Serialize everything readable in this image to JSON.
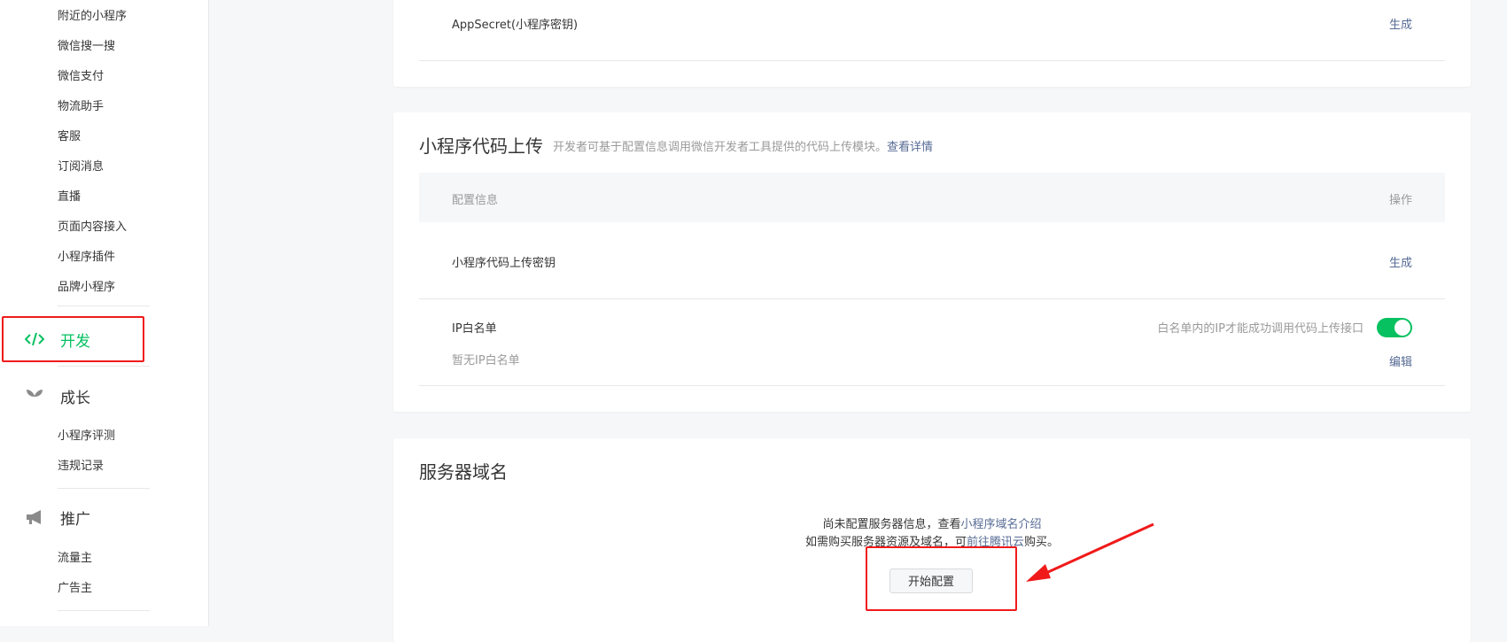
{
  "sidebar": {
    "top_items": [
      "附近的小程序",
      "微信搜一搜",
      "微信支付",
      "物流助手",
      "客服",
      "订阅消息",
      "直播",
      "页面内容接入",
      "小程序插件",
      "品牌小程序"
    ],
    "dev": {
      "label": "开发",
      "icon": "code-icon"
    },
    "growth": {
      "label": "成长",
      "icon": "sprout-icon",
      "items": [
        "小程序评测",
        "违规记录"
      ]
    },
    "promo": {
      "label": "推广",
      "icon": "megaphone-icon",
      "items": [
        "流量主",
        "广告主"
      ]
    }
  },
  "appsecret": {
    "label": "AppSecret(小程序密钥)",
    "action": "生成"
  },
  "upload": {
    "title": "小程序代码上传",
    "desc": "开发者可基于配置信息调用微信开发者工具提供的代码上传模块。",
    "desc_link": "查看详情",
    "col_config": "配置信息",
    "col_action": "操作",
    "key_label": "小程序代码上传密钥",
    "key_action": "生成",
    "ip_label": "IP白名单",
    "ip_empty": "暂无IP白名单",
    "ip_hint": "白名单内的IP才能成功调用代码上传接口",
    "ip_toggle_on": true,
    "ip_action": "编辑"
  },
  "server": {
    "title": "服务器域名",
    "line1_prefix": "尚未配置服务器信息，查看",
    "line1_link": "小程序域名介绍",
    "line2_prefix": "如需购买服务器资源及域名，可",
    "line2_link": "前往腾讯云",
    "line2_suffix": "购买。",
    "button": "开始配置"
  },
  "colors": {
    "accent": "#07c160",
    "link": "#576b95",
    "annotation": "#f01a1a"
  }
}
